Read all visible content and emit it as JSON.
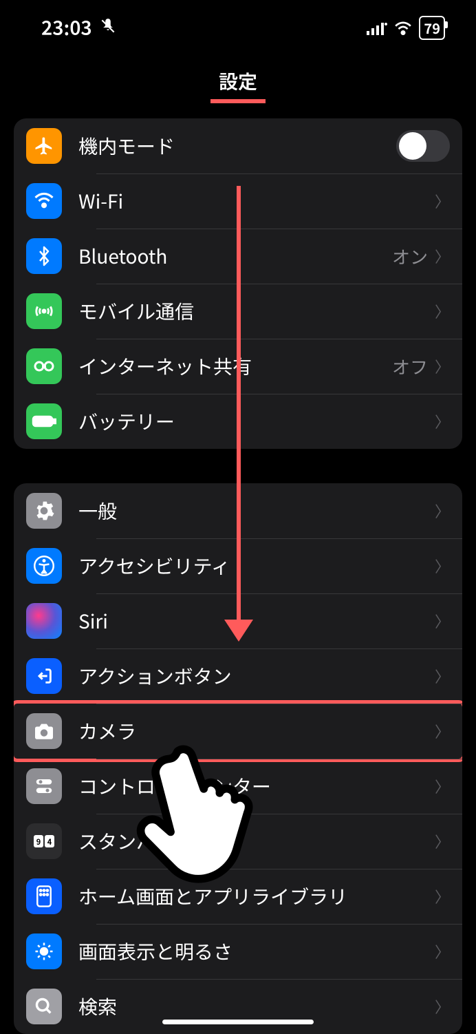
{
  "status": {
    "time": "23:03",
    "battery": "79"
  },
  "title": "設定",
  "group1": [
    {
      "key": "airplane",
      "label": "機内モード",
      "toggle": true
    },
    {
      "key": "wifi",
      "label": "Wi-Fi",
      "value": ""
    },
    {
      "key": "bluetooth",
      "label": "Bluetooth",
      "value": "オン"
    },
    {
      "key": "cellular",
      "label": "モバイル通信",
      "value": ""
    },
    {
      "key": "hotspot",
      "label": "インターネット共有",
      "value": "オフ"
    },
    {
      "key": "battery",
      "label": "バッテリー",
      "value": ""
    }
  ],
  "group2": [
    {
      "key": "general",
      "label": "一般"
    },
    {
      "key": "accessibility",
      "label": "アクセシビリティ"
    },
    {
      "key": "siri",
      "label": "Siri"
    },
    {
      "key": "action",
      "label": "アクションボタン"
    },
    {
      "key": "camera",
      "label": "カメラ",
      "highlight": true
    },
    {
      "key": "control",
      "label": "コントロールセンター"
    },
    {
      "key": "standby",
      "label": "スタンバイ"
    },
    {
      "key": "home",
      "label": "ホーム画面とアプリライブラリ"
    },
    {
      "key": "display",
      "label": "画面表示と明るさ"
    },
    {
      "key": "search",
      "label": "検索"
    }
  ]
}
